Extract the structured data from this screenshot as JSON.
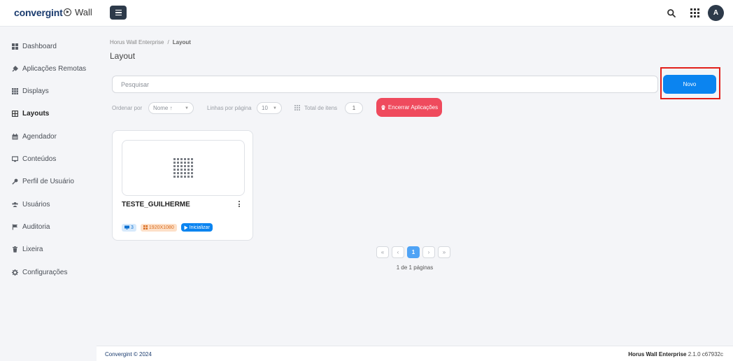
{
  "header": {
    "logo_text": "convergint",
    "app_name": "Wall",
    "avatar_initial": "A"
  },
  "sidebar": {
    "items": [
      {
        "label": "Dashboard",
        "icon": "dashboard-icon"
      },
      {
        "label": "Aplicações Remotas",
        "icon": "plug-icon"
      },
      {
        "label": "Displays",
        "icon": "grid-icon"
      },
      {
        "label": "Layouts",
        "icon": "layout-icon",
        "active": true
      },
      {
        "label": "Agendador",
        "icon": "calendar-icon"
      },
      {
        "label": "Conteúdos",
        "icon": "monitor-icon"
      },
      {
        "label": "Perfil de Usuário",
        "icon": "key-icon"
      },
      {
        "label": "Usuários",
        "icon": "users-icon"
      },
      {
        "label": "Auditoria",
        "icon": "flag-icon"
      },
      {
        "label": "Lixeira",
        "icon": "trash-icon"
      },
      {
        "label": "Configurações",
        "icon": "gear-icon"
      }
    ]
  },
  "breadcrumb": {
    "root": "Horus Wall Enterprise",
    "separator": "/",
    "current": "Layout"
  },
  "page": {
    "title": "Layout"
  },
  "search": {
    "placeholder": "Pesquisar",
    "value": ""
  },
  "actions": {
    "novo_label": "Novo",
    "encerrar_label": "Encerrar Aplicações"
  },
  "filters": {
    "order_label": "Ordenar por",
    "order_value": "Nome ↑",
    "rows_label": "Linhas por página",
    "rows_value": "10",
    "total_label": "Total de itens",
    "total_value": "1"
  },
  "layouts": [
    {
      "name": "TESTE_GUILHERME",
      "display_count": "3",
      "resolution": "1920X1080",
      "start_label": "Inicializar"
    }
  ],
  "pagination": {
    "first": "«",
    "prev": "‹",
    "current": "1",
    "next": "›",
    "last": "»",
    "info": "1 de 1 páginas"
  },
  "footer": {
    "copyright": "Convergint © 2024",
    "product": "Horus Wall Enterprise",
    "version": "2.1.0 c67932c"
  },
  "colors": {
    "primary": "#0b84f0",
    "danger": "#ef4a5d",
    "highlight": "#e2201a",
    "dark": "#2d3a4a"
  }
}
